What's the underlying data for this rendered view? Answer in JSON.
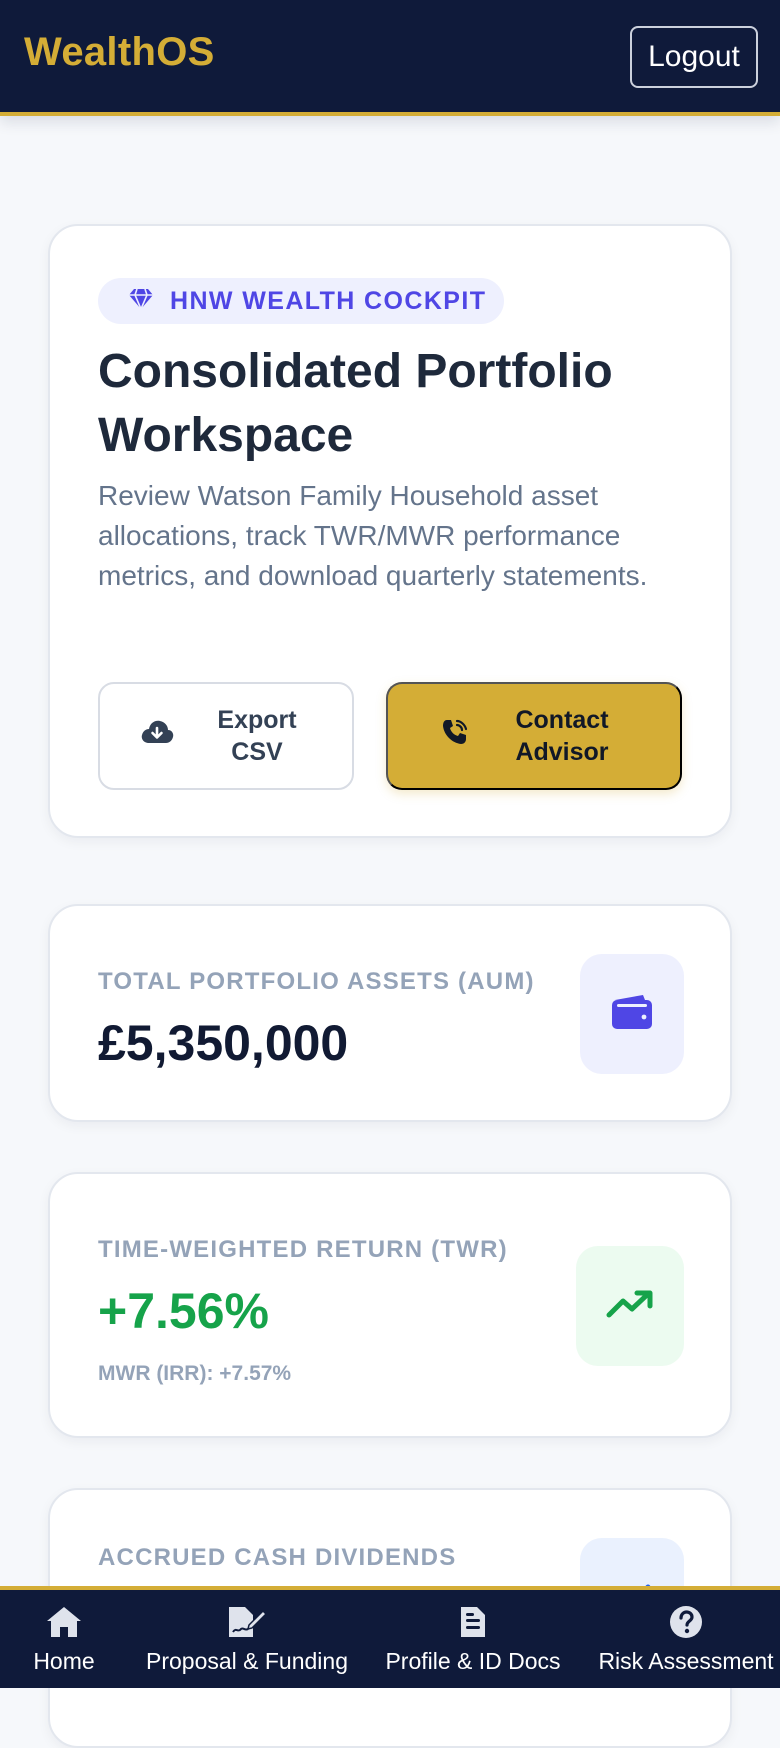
{
  "header": {
    "brand": "WealthOS",
    "logout_label": "Logout"
  },
  "hero": {
    "tag_icon": "diamond-icon",
    "tag": "HNW WEALTH COCKPIT",
    "title": "Consolidated Portfolio Workspace",
    "description": "Review Watson Family Household asset allocations, track TWR/MWR performance metrics, and download quarterly statements.",
    "export_label": "Export CSV",
    "export_icon": "cloud-download-icon",
    "contact_label": "Contact Advisor",
    "contact_icon": "phone-icon"
  },
  "stats": [
    {
      "label": "TOTAL PORTFOLIO ASSETS (AUM)",
      "value": "£5,350,000",
      "icon": "wallet-icon",
      "value_color": "#111a33"
    },
    {
      "label": "TIME-WEIGHTED RETURN (TWR)",
      "value": "+7.56%",
      "sub": "MWR (IRR): +7.57%",
      "icon": "trending-up-icon",
      "value_color": "#16a34a"
    },
    {
      "label": "ACCRUED CASH DIVIDENDS",
      "icon": "trending-up-icon"
    }
  ],
  "nav": {
    "items": [
      {
        "label": "Home",
        "icon": "home-icon"
      },
      {
        "label": "Proposal & Funding",
        "icon": "file-signature-icon"
      },
      {
        "label": "Profile & ID Docs",
        "icon": "document-icon"
      },
      {
        "label": "Risk Assessment",
        "icon": "question-circle-icon"
      }
    ]
  },
  "colors": {
    "navy": "#0f1a3a",
    "gold": "#d4ad36",
    "indigo": "#4f46e5",
    "green": "#16a34a"
  }
}
